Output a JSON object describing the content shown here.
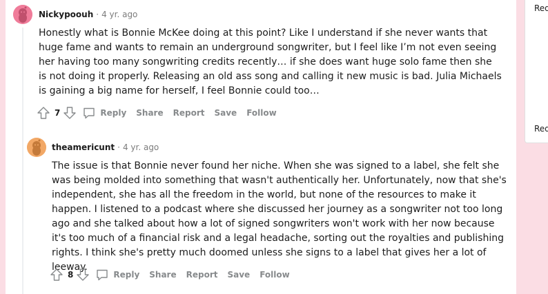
{
  "sidebar": {
    "label_top": "Red",
    "label_bottom": "Red"
  },
  "comments": [
    {
      "author": "Nickypoouh",
      "age": "4 yr. ago",
      "avatar_color": "#f07c9a",
      "body": "Honestly what is Bonnie McKee doing at this point? Like I understand if she never wants that huge fame and wants to remain an underground songwriter, but I feel like I’m not even seeing her having too many songwriting credits recently… if she does want huge solo fame then she is not doing it properly. Releasing an old ass song and calling it new music is bad. Julia Michaels is gaining a big name for herself, I feel Bonnie could too…",
      "score": "7",
      "actions": {
        "reply": "Reply",
        "share": "Share",
        "report": "Report",
        "save": "Save",
        "follow": "Follow"
      }
    },
    {
      "author": "theamericunt",
      "age": "4 yr. ago",
      "avatar_color": "#f2a866",
      "body": "The issue is that Bonnie never found her niche. When she was signed to a label, she felt she was being molded into something that wasn't authentically her. Unfortunately, now that she's independent, she has all the freedom in the world, but none of the resources to make it happen. I listened to a podcast where she discussed her journey as a songwriter not too long ago and she talked about how a lot of signed songwriters won't work with her now because it's too much of a financial risk and a legal headache, sorting out the royalties and publishing rights. I think she's pretty much doomed unless she signs to a label that gives her a lot of leeway.",
      "score": "8",
      "actions": {
        "reply": "Reply",
        "share": "Share",
        "report": "Report",
        "save": "Save",
        "follow": "Follow"
      }
    }
  ],
  "colors": {
    "background": "#fbdde4",
    "text": "#1c1c1c",
    "muted": "#7c7c7c",
    "action": "#878a8c"
  }
}
